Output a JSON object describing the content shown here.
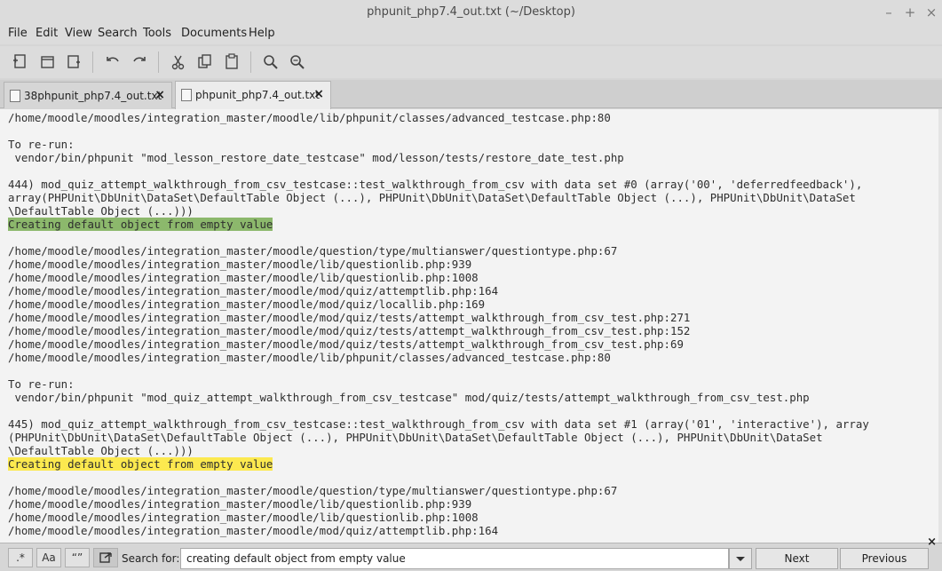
{
  "window": {
    "title": "phpunit_php7.4_out.txt (~/Desktop)",
    "controls": {
      "minimize": "–",
      "maximize": "+",
      "close": "×"
    }
  },
  "menu": {
    "items": [
      "File",
      "Edit",
      "View",
      "Search",
      "Tools",
      "Documents",
      "Help"
    ]
  },
  "toolbar": {
    "buttons": [
      "new-document-icon",
      "open-document-icon",
      "save-document-icon",
      "undo-icon",
      "redo-icon",
      "cut-icon",
      "copy-icon",
      "paste-icon",
      "find-icon",
      "find-replace-icon"
    ]
  },
  "tabs": [
    {
      "label": "38phpunit_php7.4_out.txt",
      "close": "×",
      "active": false
    },
    {
      "label": "phpunit_php7.4_out.txt",
      "close": "×",
      "active": true
    }
  ],
  "editor": {
    "lines": [
      "/home/moodle/moodles/integration_master/moodle/lib/phpunit/classes/advanced_testcase.php:80",
      "",
      "To re-run:",
      " vendor/bin/phpunit \"mod_lesson_restore_date_testcase\" mod/lesson/tests/restore_date_test.php",
      "",
      "444) mod_quiz_attempt_walkthrough_from_csv_testcase::test_walkthrough_from_csv with data set #0 (array('00', 'deferredfeedback'),",
      "array(PHPUnit\\DbUnit\\DataSet\\DefaultTable Object (...), PHPUnit\\DbUnit\\DataSet\\DefaultTable Object (...), PHPUnit\\DbUnit\\DataSet",
      "\\DefaultTable Object (...)))",
      "Creating default object from empty value",
      "",
      "/home/moodle/moodles/integration_master/moodle/question/type/multianswer/questiontype.php:67",
      "/home/moodle/moodles/integration_master/moodle/lib/questionlib.php:939",
      "/home/moodle/moodles/integration_master/moodle/lib/questionlib.php:1008",
      "/home/moodle/moodles/integration_master/moodle/mod/quiz/attemptlib.php:164",
      "/home/moodle/moodles/integration_master/moodle/mod/quiz/locallib.php:169",
      "/home/moodle/moodles/integration_master/moodle/mod/quiz/tests/attempt_walkthrough_from_csv_test.php:271",
      "/home/moodle/moodles/integration_master/moodle/mod/quiz/tests/attempt_walkthrough_from_csv_test.php:152",
      "/home/moodle/moodles/integration_master/moodle/mod/quiz/tests/attempt_walkthrough_from_csv_test.php:69",
      "/home/moodle/moodles/integration_master/moodle/lib/phpunit/classes/advanced_testcase.php:80",
      "",
      "To re-run:",
      " vendor/bin/phpunit \"mod_quiz_attempt_walkthrough_from_csv_testcase\" mod/quiz/tests/attempt_walkthrough_from_csv_test.php",
      "",
      "445) mod_quiz_attempt_walkthrough_from_csv_testcase::test_walkthrough_from_csv with data set #1 (array('01', 'interactive'), array",
      "(PHPUnit\\DbUnit\\DataSet\\DefaultTable Object (...), PHPUnit\\DbUnit\\DataSet\\DefaultTable Object (...), PHPUnit\\DbUnit\\DataSet",
      "\\DefaultTable Object (...)))",
      "Creating default object from empty value",
      "",
      "/home/moodle/moodles/integration_master/moodle/question/type/multianswer/questiontype.php:67",
      "/home/moodle/moodles/integration_master/moodle/lib/questionlib.php:939",
      "/home/moodle/moodles/integration_master/moodle/lib/questionlib.php:1008",
      "/home/moodle/moodles/integration_master/moodle/mod/quiz/attemptlib.php:164"
    ],
    "highlight_match_line": 8,
    "highlight_current_line": 26,
    "highlight_colors": {
      "match": "#8cb86c",
      "current": "#fce94f"
    }
  },
  "search": {
    "toggles": [
      ".*",
      "Aa",
      "“”",
      "wrap-around-icon"
    ],
    "label": "Search for:",
    "value": "creating default object from empty value",
    "next_label": "Next",
    "previous_label": "Previous",
    "close": "×"
  }
}
